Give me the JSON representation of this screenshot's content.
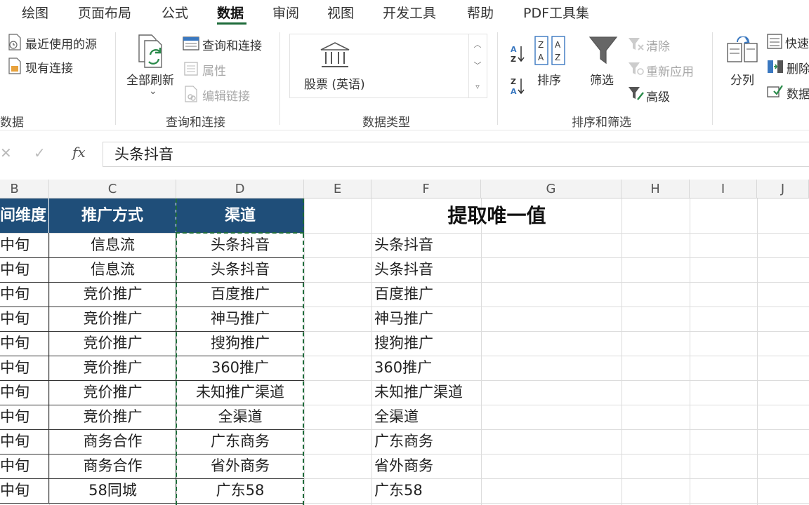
{
  "menu": {
    "tabs": [
      "绘图",
      "页面布局",
      "公式",
      "数据",
      "审阅",
      "视图",
      "开发工具",
      "帮助",
      "PDF工具集"
    ],
    "active": "数据"
  },
  "ribbon": {
    "get_data": {
      "recent_sources": "最近使用的源",
      "existing_connections": "现有连接",
      "group_label": "数据"
    },
    "queries": {
      "refresh_all": "全部刷新",
      "refresh_all_arrow": "⌄",
      "queries_connections": "查询和连接",
      "properties": "属性",
      "edit_links": "编辑链接",
      "group_label": "查询和连接"
    },
    "data_types": {
      "stocks": "股票 (英语)",
      "group_label": "数据类型"
    },
    "sort_filter": {
      "sort": "排序",
      "filter": "筛选",
      "clear": "清除",
      "reapply": "重新应用",
      "advanced": "高级",
      "group_label": "排序和筛选"
    },
    "data_tools": {
      "text_to_columns": "分列",
      "flash_fill": "快速",
      "remove_duplicates": "删除",
      "data_validation": "数据"
    }
  },
  "formula_bar": {
    "cancel": "✕",
    "enter": "✓",
    "fx": "fx",
    "value": "头条抖音"
  },
  "grid": {
    "columns": [
      "B",
      "C",
      "D",
      "E",
      "F",
      "G",
      "H",
      "I",
      "J"
    ],
    "header": {
      "B": "间维度",
      "C": "推广方式",
      "D": "渠道",
      "F": "提取唯一值"
    },
    "rows": [
      {
        "B": "中旬",
        "C": "信息流",
        "D": "头条抖音",
        "F": "头条抖音"
      },
      {
        "B": "中旬",
        "C": "信息流",
        "D": "头条抖音",
        "F": "头条抖音"
      },
      {
        "B": "中旬",
        "C": "竞价推广",
        "D": "百度推广",
        "F": "百度推广"
      },
      {
        "B": "中旬",
        "C": "竞价推广",
        "D": "神马推广",
        "F": "神马推广"
      },
      {
        "B": "中旬",
        "C": "竞价推广",
        "D": "搜狗推广",
        "F": "搜狗推广"
      },
      {
        "B": "中旬",
        "C": "竞价推广",
        "D": "360推广",
        "F": "360推广"
      },
      {
        "B": "中旬",
        "C": "竞价推广",
        "D": "未知推广渠道",
        "F": "未知推广渠道"
      },
      {
        "B": "中旬",
        "C": "竞价推广",
        "D": "全渠道",
        "F": "全渠道"
      },
      {
        "B": "中旬",
        "C": "商务合作",
        "D": "广东商务",
        "F": "广东商务"
      },
      {
        "B": "中旬",
        "C": "商务合作",
        "D": "省外商务",
        "F": "省外商务"
      },
      {
        "B": "中旬",
        "C": "58同城",
        "D": "广东58",
        "F": "广东58"
      }
    ]
  },
  "colors": {
    "header_fill": "#1f4e79",
    "header_text": "#ffffff",
    "selection": "#1e6b3a"
  }
}
